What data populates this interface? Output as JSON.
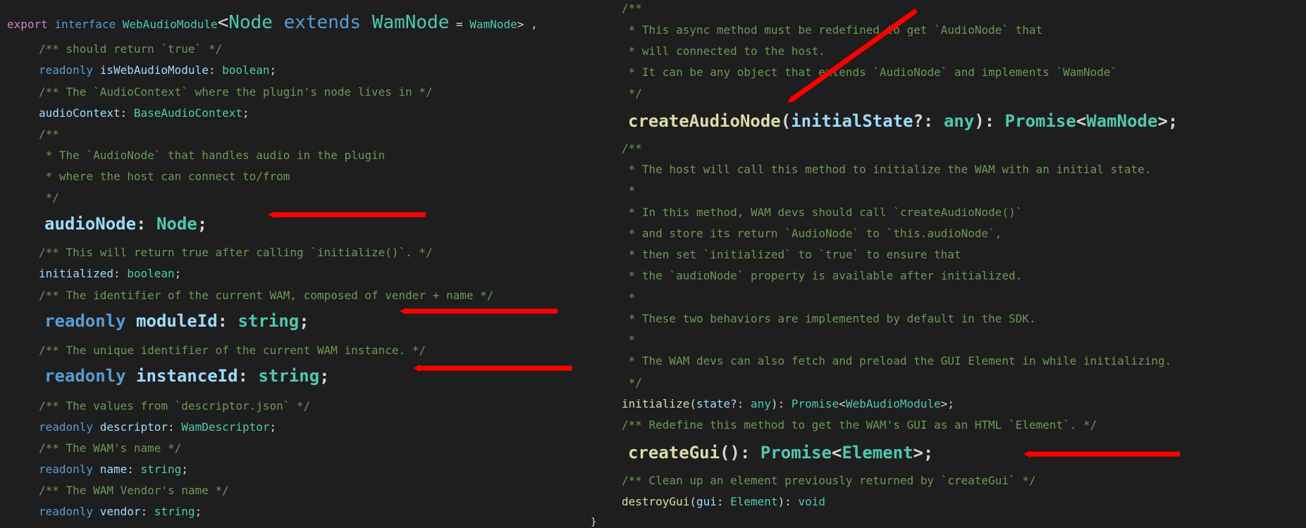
{
  "left_panel": {
    "header": [
      {
        "text": "export",
        "cls": "kw-purple"
      },
      {
        "text": " ",
        "cls": "pun"
      },
      {
        "text": "interface",
        "cls": "kw"
      },
      {
        "text": " ",
        "cls": "pun"
      },
      {
        "text": "WebAudioModule",
        "cls": "type"
      },
      {
        "text": "<",
        "cls": "pun",
        "big": true
      },
      {
        "text": "Node",
        "cls": "type",
        "big": true
      },
      {
        "text": " ",
        "cls": "pun",
        "big": true
      },
      {
        "text": "extends",
        "cls": "kw",
        "big": true
      },
      {
        "text": " ",
        "cls": "pun",
        "big": true
      },
      {
        "text": "WamNode",
        "cls": "type",
        "big": true
      },
      {
        "text": " = ",
        "cls": "pun"
      },
      {
        "text": "WamNode",
        "cls": "type"
      },
      {
        "text": "> ,",
        "cls": "pun"
      }
    ],
    "lines": [
      [
        {
          "text": "/** should return `true` */",
          "cls": "cmt"
        }
      ],
      [
        {
          "text": "readonly",
          "cls": "kw"
        },
        {
          "text": " ",
          "cls": "pun"
        },
        {
          "text": "isWebAudioModule",
          "cls": "prop"
        },
        {
          "text": ": ",
          "cls": "pun"
        },
        {
          "text": "boolean",
          "cls": "type"
        },
        {
          "text": ";",
          "cls": "pun"
        }
      ],
      [
        {
          "text": "/** The `AudioContext` where the plugin's node lives in */",
          "cls": "cmt"
        }
      ],
      [
        {
          "text": "audioContext",
          "cls": "prop"
        },
        {
          "text": ": ",
          "cls": "pun"
        },
        {
          "text": "BaseAudioContext",
          "cls": "type"
        },
        {
          "text": ";",
          "cls": "pun"
        }
      ],
      [
        {
          "text": "/**",
          "cls": "cmt"
        }
      ],
      [
        {
          "text": " * The `AudioNode` that handles audio in the plugin",
          "cls": "cmt"
        }
      ],
      [
        {
          "text": " * where the host can connect to/from",
          "cls": "cmt"
        }
      ],
      [
        {
          "text": " */",
          "cls": "cmt"
        }
      ],
      [
        {
          "text": "audioNode",
          "cls": "prop"
        },
        {
          "text": ": ",
          "cls": "pun"
        },
        {
          "text": "Node",
          "cls": "type"
        },
        {
          "text": ";",
          "cls": "pun"
        }
      ],
      [
        {
          "text": "/** This will return true after calling `initialize()`. */",
          "cls": "cmt"
        }
      ],
      [
        {
          "text": "initialized",
          "cls": "prop"
        },
        {
          "text": ": ",
          "cls": "pun"
        },
        {
          "text": "boolean",
          "cls": "type"
        },
        {
          "text": ";",
          "cls": "pun"
        }
      ],
      [
        {
          "text": "/** The identifier of the current WAM, composed of vender + name */",
          "cls": "cmt"
        }
      ],
      [
        {
          "text": "readonly",
          "cls": "kw"
        },
        {
          "text": " ",
          "cls": "pun"
        },
        {
          "text": "moduleId",
          "cls": "prop"
        },
        {
          "text": ": ",
          "cls": "pun"
        },
        {
          "text": "string",
          "cls": "type"
        },
        {
          "text": ";",
          "cls": "pun"
        }
      ],
      [
        {
          "text": "/** The unique identifier of the current WAM instance. */",
          "cls": "cmt"
        }
      ],
      [
        {
          "text": "readonly",
          "cls": "kw"
        },
        {
          "text": " ",
          "cls": "pun"
        },
        {
          "text": "instanceId",
          "cls": "prop"
        },
        {
          "text": ": ",
          "cls": "pun"
        },
        {
          "text": "string",
          "cls": "type"
        },
        {
          "text": ";",
          "cls": "pun"
        }
      ],
      [
        {
          "text": "/** The values from `descriptor.json` */",
          "cls": "cmt"
        }
      ],
      [
        {
          "text": "readonly",
          "cls": "kw"
        },
        {
          "text": " ",
          "cls": "pun"
        },
        {
          "text": "descriptor",
          "cls": "prop"
        },
        {
          "text": ": ",
          "cls": "pun"
        },
        {
          "text": "WamDescriptor",
          "cls": "type"
        },
        {
          "text": ";",
          "cls": "pun"
        }
      ],
      [
        {
          "text": "/** The WAM's name */",
          "cls": "cmt"
        }
      ],
      [
        {
          "text": "readonly",
          "cls": "kw"
        },
        {
          "text": " ",
          "cls": "pun"
        },
        {
          "text": "name",
          "cls": "prop"
        },
        {
          "text": ": ",
          "cls": "pun"
        },
        {
          "text": "string",
          "cls": "type"
        },
        {
          "text": ";",
          "cls": "pun"
        }
      ],
      [
        {
          "text": "/** The WAM Vendor's name */",
          "cls": "cmt"
        }
      ],
      [
        {
          "text": "readonly",
          "cls": "kw"
        },
        {
          "text": " ",
          "cls": "pun"
        },
        {
          "text": "vendor",
          "cls": "prop"
        },
        {
          "text": ": ",
          "cls": "pun"
        },
        {
          "text": "string",
          "cls": "type"
        },
        {
          "text": ";",
          "cls": "pun"
        }
      ]
    ]
  },
  "right_panel": {
    "lines": [
      [
        {
          "text": "/**",
          "cls": "cmt"
        }
      ],
      [
        {
          "text": " * This async method must be redefined to get `AudioNode` that",
          "cls": "cmt"
        }
      ],
      [
        {
          "text": " * will connected to the host.",
          "cls": "cmt"
        }
      ],
      [
        {
          "text": " * It can be any object that extends `AudioNode` and implements `WamNode`",
          "cls": "cmt"
        }
      ],
      [
        {
          "text": " */",
          "cls": "cmt"
        }
      ],
      [
        {
          "text": "createAudioNode",
          "cls": "fn"
        },
        {
          "text": "(",
          "cls": "pun"
        },
        {
          "text": "initialState",
          "cls": "prop"
        },
        {
          "text": "?: ",
          "cls": "pun"
        },
        {
          "text": "any",
          "cls": "type"
        },
        {
          "text": "): ",
          "cls": "pun"
        },
        {
          "text": "Promise",
          "cls": "type"
        },
        {
          "text": "<",
          "cls": "pun"
        },
        {
          "text": "WamNode",
          "cls": "type"
        },
        {
          "text": ">;",
          "cls": "pun"
        }
      ],
      [
        {
          "text": "/**",
          "cls": "cmt"
        }
      ],
      [
        {
          "text": " * The host will call this method to initialize the WAM with an initial state.",
          "cls": "cmt"
        }
      ],
      [
        {
          "text": " *",
          "cls": "cmt"
        }
      ],
      [
        {
          "text": " * In this method, WAM devs should call `createAudioNode()`",
          "cls": "cmt"
        }
      ],
      [
        {
          "text": " * and store its return `AudioNode` to `this.audioNode`,",
          "cls": "cmt"
        }
      ],
      [
        {
          "text": " * then set `initialized` to `true` to ensure that",
          "cls": "cmt"
        }
      ],
      [
        {
          "text": " * the `audioNode` property is available after initialized.",
          "cls": "cmt"
        }
      ],
      [
        {
          "text": " *",
          "cls": "cmt"
        }
      ],
      [
        {
          "text": " * These two behaviors are implemented by default in the SDK.",
          "cls": "cmt"
        }
      ],
      [
        {
          "text": " *",
          "cls": "cmt"
        }
      ],
      [
        {
          "text": " * The WAM devs can also fetch and preload the GUI Element in while initializing.",
          "cls": "cmt"
        }
      ],
      [
        {
          "text": " */",
          "cls": "cmt"
        }
      ],
      [
        {
          "text": "initialize",
          "cls": "fn"
        },
        {
          "text": "(",
          "cls": "pun"
        },
        {
          "text": "state",
          "cls": "prop"
        },
        {
          "text": "?: ",
          "cls": "pun"
        },
        {
          "text": "any",
          "cls": "type"
        },
        {
          "text": "): ",
          "cls": "pun"
        },
        {
          "text": "Promise",
          "cls": "type"
        },
        {
          "text": "<",
          "cls": "pun"
        },
        {
          "text": "WebAudioModule",
          "cls": "type"
        },
        {
          "text": ">;",
          "cls": "pun"
        }
      ],
      [
        {
          "text": "/** Redefine this method to get the WAM's GUI as an HTML `Element`. */",
          "cls": "cmt"
        }
      ],
      [
        {
          "text": "createGui",
          "cls": "fn"
        },
        {
          "text": "(): ",
          "cls": "pun"
        },
        {
          "text": "Promise",
          "cls": "type"
        },
        {
          "text": "<",
          "cls": "pun"
        },
        {
          "text": "Element",
          "cls": "type"
        },
        {
          "text": ">;",
          "cls": "pun"
        }
      ],
      [
        {
          "text": "/** Clean up an element previously returned by `createGui` */",
          "cls": "cmt"
        }
      ],
      [
        {
          "text": "destroyGui",
          "cls": "fn"
        },
        {
          "text": "(",
          "cls": "pun"
        },
        {
          "text": "gui",
          "cls": "prop"
        },
        {
          "text": ": ",
          "cls": "pun"
        },
        {
          "text": "Element",
          "cls": "type"
        },
        {
          "text": "): ",
          "cls": "pun"
        },
        {
          "text": "void",
          "cls": "type"
        }
      ]
    ],
    "closing_brace": "}"
  },
  "colors": {
    "background": "#1e1e1e",
    "annotation_arrow": "#ff0000"
  }
}
